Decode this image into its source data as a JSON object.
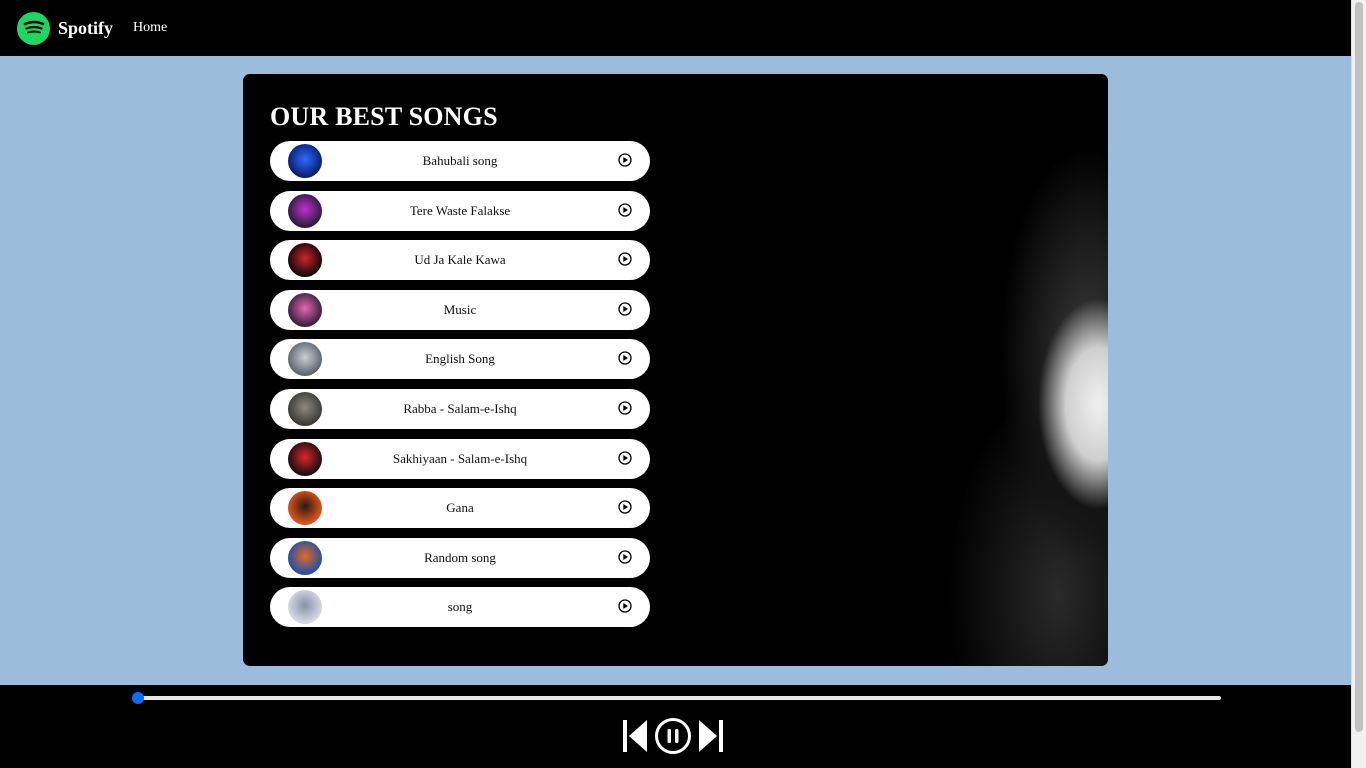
{
  "nav": {
    "brand": "Spotify",
    "links": [
      "Home"
    ]
  },
  "main": {
    "title": "OUR BEST SONGS",
    "songs": [
      {
        "name": "Bahubali song",
        "cover_colors": [
          "#0b1d6e",
          "#2a6cff"
        ]
      },
      {
        "name": "Tere Waste Falakse",
        "cover_colors": [
          "#2a1b3d",
          "#c22fd1"
        ]
      },
      {
        "name": "Ud Ja Kale Kawa",
        "cover_colors": [
          "#120608",
          "#d0252b"
        ]
      },
      {
        "name": "Music",
        "cover_colors": [
          "#3a1e3e",
          "#e06ab0"
        ]
      },
      {
        "name": "English Song",
        "cover_colors": [
          "#5c6670",
          "#c9d0d6"
        ]
      },
      {
        "name": "Rabba - Salam-e-Ishq",
        "cover_colors": [
          "#3b3a36",
          "#8e8a80"
        ]
      },
      {
        "name": "Sakhiyaan - Salam-e-Ishq",
        "cover_colors": [
          "#150f0f",
          "#e0242a"
        ]
      },
      {
        "name": "Gana",
        "cover_colors": [
          "#e2561b",
          "#2b1a12"
        ]
      },
      {
        "name": "Random song",
        "cover_colors": [
          "#1f4fa8",
          "#e8681e"
        ]
      },
      {
        "name": "song",
        "cover_colors": [
          "#d7dae6",
          "#8a90a8"
        ]
      }
    ]
  },
  "player": {
    "progress": 0,
    "accent": "#0d6efd",
    "controls": [
      "previous-icon",
      "pause-icon",
      "next-icon"
    ]
  },
  "colors": {
    "background": "#9bbcdb",
    "spotify_green": "#1ed760"
  }
}
